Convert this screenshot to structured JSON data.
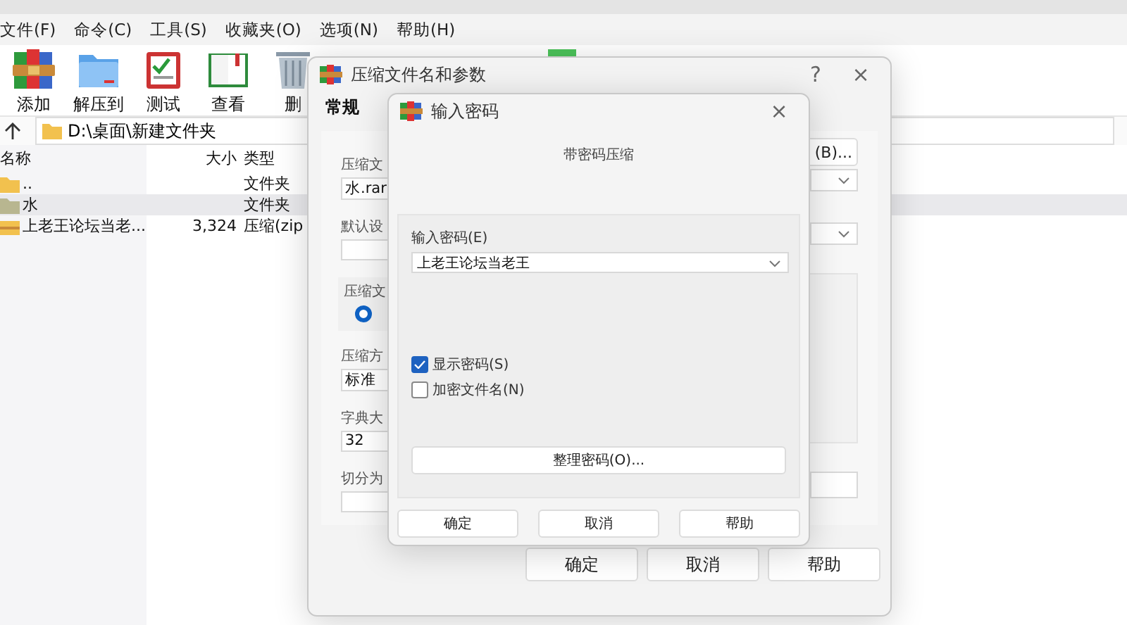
{
  "main_window": {
    "menu": [
      "文件(F)",
      "命令(C)",
      "工具(S)",
      "收藏夹(O)",
      "选项(N)",
      "帮助(H)"
    ],
    "toolbar": [
      {
        "kind": "add",
        "label": "添加"
      },
      {
        "kind": "extract",
        "label": "解压到"
      },
      {
        "kind": "test",
        "label": "测试"
      },
      {
        "kind": "view",
        "label": "查看"
      },
      {
        "kind": "delete",
        "label": "删"
      }
    ],
    "address": "D:\\桌面\\新建文件夹",
    "columns": [
      "名称",
      "大小",
      "类型"
    ],
    "rows": [
      {
        "kind": "up",
        "name": "..",
        "type": "文件夹",
        "selected": false
      },
      {
        "kind": "folder",
        "name": "水",
        "type": "文件夹",
        "selected": true
      },
      {
        "kind": "archive",
        "name": "上老王论坛当老...",
        "size": "3,324",
        "type": "压缩(zip",
        "selected": false
      }
    ]
  },
  "archive_dialog": {
    "title": "压缩文件名和参数",
    "help": "?",
    "close": "×",
    "tabs": [
      {
        "label": "常规",
        "selected": true
      }
    ],
    "archive_label": "压缩文",
    "archive_name": "水.rar",
    "browse": "(B)...",
    "profile_label": "默认设",
    "format_label": "压缩文",
    "format_selected": true,
    "method_label": "压缩方",
    "method": "标准",
    "dict_label": "字典大",
    "dict": "32",
    "split_label": "切分为",
    "buttons": [
      "确定",
      "取消",
      "帮助"
    ]
  },
  "password_dialog": {
    "title": "输入密码",
    "close": "×",
    "subtitle": "带密码压缩",
    "password_label": "输入密码(E)",
    "password": "上老王论坛当老王",
    "options": [
      {
        "label": "显示密码(S)",
        "checked": true
      },
      {
        "label": "加密文件名(N)",
        "checked": false
      }
    ],
    "organize": "整理密码(O)...",
    "buttons": [
      "确定",
      "取消",
      "帮助"
    ]
  }
}
